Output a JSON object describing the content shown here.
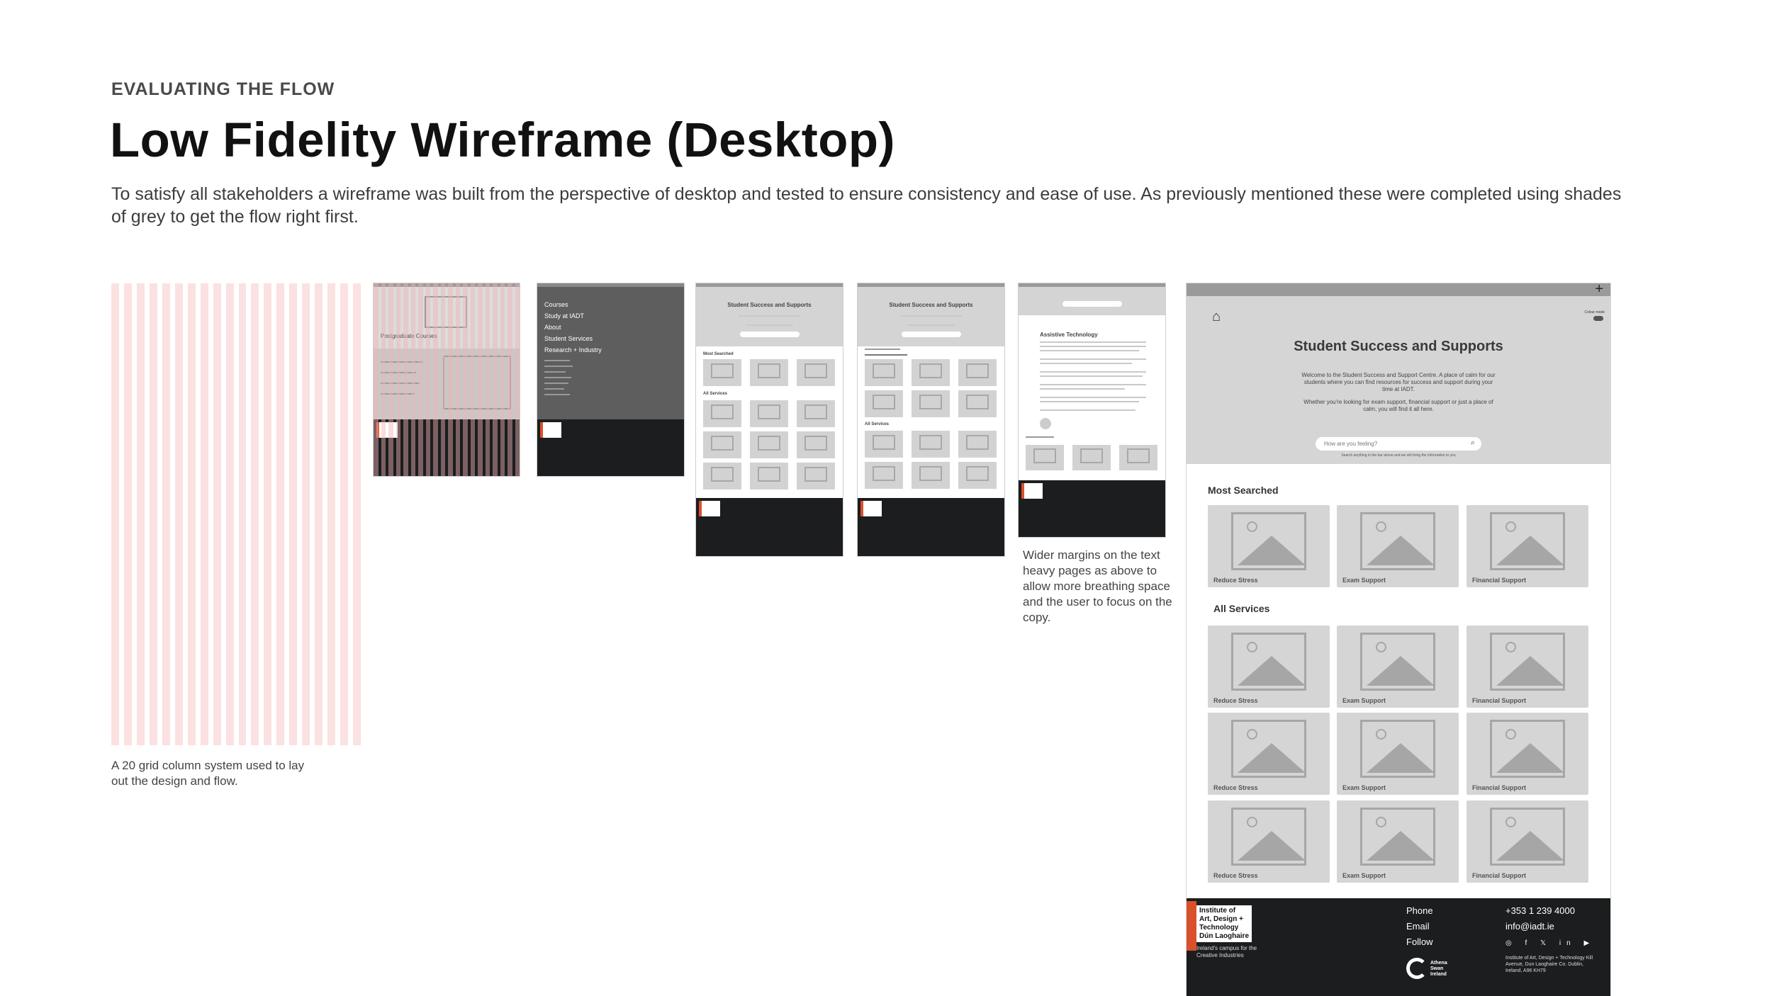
{
  "header": {
    "eyebrow": "EVALUATING THE FLOW",
    "title": "Low Fidelity Wireframe (Desktop)",
    "intro": "To satisfy all stakeholders a wireframe was built from the perspective of desktop and tested to ensure consistency and ease of use. As previously mentioned these were completed using shades of grey to get the flow right first."
  },
  "grid": {
    "columns": 20,
    "caption": "A 20 grid column system used to lay out the design and flow."
  },
  "menu_thumb": {
    "items": [
      "Courses",
      "Study at IADT",
      "About",
      "Student Services",
      "Research + Industry"
    ]
  },
  "thumbs": {
    "student_title": "Student Success and Supports",
    "assistive_title": "Assistive Technology"
  },
  "wide_caption": "Wider margins on the text heavy pages as above to allow more breathing space and the user to focus on the copy.",
  "wireframe": {
    "hero_title": "Student Success and Supports",
    "hero_p1": "Welcome to the Student Success and Support Centre. A place of calm for our students where you can find resources for success and support during your time at IADT.",
    "hero_p2": "Whether you're looking for exam support, financial support or just a place of calm, you will find it all here.",
    "search_placeholder": "How are you feeling?",
    "search_hint": "Search anything in the bar above and we will bring the information to you",
    "most_searched_label": "Most Searched",
    "most_searched": [
      "Reduce Stress",
      "Exam Support",
      "Financial Support"
    ],
    "all_services_label": "All Services",
    "all_services": [
      "Reduce Stress",
      "Exam Support",
      "Financial Support",
      "Reduce Stress",
      "Exam Support",
      "Financial Support",
      "Reduce Stress",
      "Exam Support",
      "Financial Support"
    ],
    "footer": {
      "logo_lines": "Institute of Art, Design + Technology Dún Laoghaire",
      "tagline": "Ireland's campus for the Creative Industries",
      "phone_label": "Phone",
      "phone": "+353 1 239 4000",
      "email_label": "Email",
      "email": "info@iadt.ie",
      "follow_label": "Follow",
      "social": "◎ f 𝕏 in ▶",
      "address": "Institute of Art, Design + Technology Kill Avenue, Dun Laoghaire Co. Dublin, Ireland, A96 KH79",
      "mark_text": "Athena Swan Ireland"
    }
  },
  "colors": {
    "grid_pink": "#fbe1e1",
    "footer_dark": "#1b1d1f",
    "accent_orange": "#d9502b",
    "wire_grey": "#d5d5d5"
  }
}
